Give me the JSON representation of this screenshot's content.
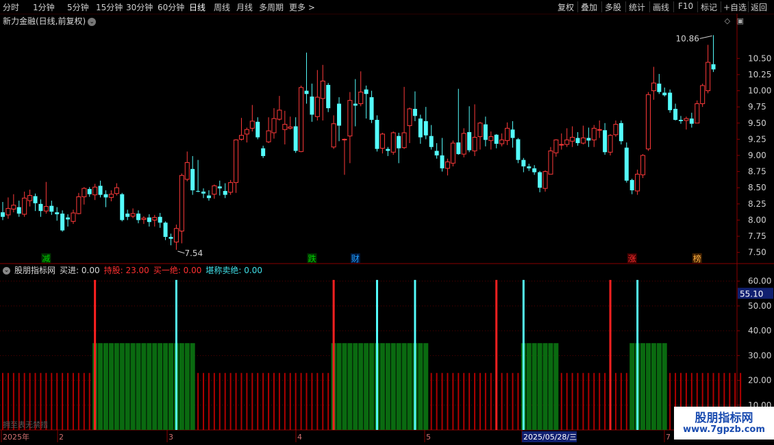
{
  "toolbar": {
    "left": [
      "分时",
      "1分钟",
      "5分钟",
      "15分钟",
      "30分钟",
      "60分钟",
      "日线",
      "周线",
      "月线",
      "多周期",
      "更多 >"
    ],
    "active": "日线",
    "right": [
      "复权",
      "叠加",
      "多股",
      "统计",
      "画线",
      "F10",
      "标记",
      "+自选",
      "返回"
    ]
  },
  "stock": {
    "title": "新力金融(日线,前复权)",
    "chevron": "⌄"
  },
  "price_axis": {
    "labels": [
      "10.50",
      "10.25",
      "10.00",
      "9.75",
      "9.50",
      "9.25",
      "9.00",
      "8.75",
      "8.50",
      "8.25",
      "8.00",
      "7.75",
      "7.50"
    ]
  },
  "annotations": {
    "high": "10.86",
    "low": "7.54"
  },
  "markers": [
    {
      "text": "减",
      "color": "#00d000",
      "bg": "#003000"
    },
    {
      "text": "跌",
      "color": "#00d000",
      "bg": "#003000"
    },
    {
      "text": "财",
      "color": "#20a0ff",
      "bg": "#001a40"
    },
    {
      "text": "涨",
      "color": "#ff3030",
      "bg": "#400000"
    },
    {
      "text": "榜",
      "color": "#ffb040",
      "bg": "#402000"
    }
  ],
  "indicator": {
    "name": "股朋指标网",
    "buy": "买进: 0.00",
    "hold": "持股: 23.00",
    "buy_all": "买一绝: 0.00",
    "sell_all": "堪称卖绝: 0.00",
    "axis_labels": [
      "60.00",
      "50.00",
      "40.00",
      "30.00",
      "20.00",
      "10.00"
    ],
    "current": "55.10"
  },
  "time_axis": {
    "labels": [
      "2025年",
      "2",
      "3",
      "4",
      "5",
      "2025/05/28/三",
      "7"
    ]
  },
  "watermark": {
    "cn": "股朋指标网",
    "url": "www.7gpzb.com"
  },
  "bottom_note": "拥至表无禁措",
  "chart_data": {
    "type": "candlestick",
    "ylim": [
      7.38,
      10.98
    ],
    "candles": [
      [
        8.12,
        8.05,
        8.28,
        8.0
      ],
      [
        8.08,
        8.18,
        8.35,
        8.02
      ],
      [
        8.17,
        8.23,
        8.4,
        8.12
      ],
      [
        8.2,
        8.1,
        8.3,
        8.05
      ],
      [
        8.09,
        8.34,
        8.44,
        8.05
      ],
      [
        8.3,
        8.38,
        8.47,
        8.21
      ],
      [
        8.37,
        8.26,
        8.41,
        8.14
      ],
      [
        8.25,
        8.14,
        8.32,
        8.05
      ],
      [
        8.14,
        8.21,
        8.59,
        8.1
      ],
      [
        8.22,
        8.13,
        8.3,
        8.08
      ],
      [
        8.12,
        8.09,
        8.2,
        7.99
      ],
      [
        8.1,
        7.84,
        8.15,
        7.82
      ],
      [
        8.04,
        8.01,
        8.09,
        7.9
      ],
      [
        7.98,
        8.11,
        8.16,
        7.94
      ],
      [
        8.1,
        8.36,
        8.42,
        8.09
      ],
      [
        8.36,
        8.49,
        8.51,
        8.24
      ],
      [
        8.48,
        8.4,
        8.51,
        8.36
      ],
      [
        8.39,
        8.51,
        8.56,
        8.31
      ],
      [
        8.53,
        8.39,
        8.61,
        8.35
      ],
      [
        8.4,
        8.35,
        8.46,
        8.2
      ],
      [
        8.35,
        8.4,
        8.46,
        8.29
      ],
      [
        8.41,
        8.5,
        8.57,
        8.38
      ],
      [
        8.4,
        8.0,
        8.42,
        7.98
      ],
      [
        8.1,
        8.05,
        8.16,
        8.0
      ],
      [
        8.06,
        8.1,
        8.18,
        8.03
      ],
      [
        8.1,
        8.0,
        8.15,
        7.95
      ],
      [
        8.01,
        8.03,
        8.06,
        7.94
      ],
      [
        8.04,
        7.97,
        8.09,
        7.9
      ],
      [
        8.0,
        8.04,
        8.08,
        7.9
      ],
      [
        8.05,
        7.96,
        8.11,
        7.88
      ],
      [
        7.96,
        7.74,
        7.98,
        7.69
      ],
      [
        7.74,
        7.71,
        7.79,
        7.61
      ],
      [
        7.66,
        7.87,
        7.93,
        7.54
      ],
      [
        7.83,
        8.69,
        8.72,
        7.64
      ],
      [
        8.63,
        8.89,
        9.06,
        8.6
      ],
      [
        8.79,
        8.46,
        8.99,
        8.39
      ],
      [
        8.45,
        8.44,
        8.93,
        8.43
      ],
      [
        8.44,
        8.41,
        8.49,
        8.34
      ],
      [
        8.38,
        8.34,
        8.46,
        8.3
      ],
      [
        8.4,
        8.53,
        8.55,
        8.33
      ],
      [
        8.52,
        8.49,
        8.61,
        8.38
      ],
      [
        8.45,
        8.39,
        8.57,
        8.34
      ],
      [
        8.43,
        8.58,
        8.62,
        8.39
      ],
      [
        8.58,
        9.24,
        9.25,
        8.42
      ],
      [
        9.25,
        9.31,
        9.58,
        9.23
      ],
      [
        9.33,
        9.4,
        9.43,
        9.2
      ],
      [
        9.42,
        9.53,
        9.78,
        9.37
      ],
      [
        9.52,
        9.28,
        9.59,
        9.25
      ],
      [
        9.11,
        8.99,
        9.15,
        8.96
      ],
      [
        9.21,
        9.38,
        9.59,
        9.19
      ],
      [
        9.35,
        9.57,
        9.73,
        9.26
      ],
      [
        9.56,
        9.7,
        9.92,
        9.54
      ],
      [
        9.4,
        9.48,
        9.69,
        9.17
      ],
      [
        9.42,
        9.44,
        9.6,
        9.4
      ],
      [
        9.45,
        9.07,
        9.59,
        9.04
      ],
      [
        9.06,
        10.05,
        10.08,
        9.05
      ],
      [
        10.0,
        9.95,
        10.59,
        9.8
      ],
      [
        9.91,
        9.63,
        10.11,
        9.52
      ],
      [
        9.6,
        9.9,
        10.32,
        9.54
      ],
      [
        9.88,
        10.15,
        10.4,
        9.54
      ],
      [
        10.09,
        9.73,
        10.12,
        9.67
      ],
      [
        9.13,
        9.49,
        9.62,
        9.1
      ],
      [
        9.8,
        9.46,
        9.9,
        9.22
      ],
      [
        9.24,
        9.25,
        9.26,
        8.7
      ],
      [
        9.3,
        9.85,
        9.98,
        8.88
      ],
      [
        9.8,
        9.77,
        10.18,
        9.45
      ],
      [
        9.8,
        9.98,
        10.3,
        9.76
      ],
      [
        10.02,
        9.95,
        10.08,
        9.57
      ],
      [
        9.9,
        9.55,
        10.0,
        9.5
      ],
      [
        9.55,
        9.1,
        9.62,
        9.06
      ],
      [
        9.11,
        9.33,
        9.35,
        9.03
      ],
      [
        9.1,
        9.07,
        9.13,
        8.99
      ],
      [
        9.05,
        9.35,
        9.37,
        9.01
      ],
      [
        9.3,
        9.11,
        9.35,
        8.88
      ],
      [
        9.12,
        9.35,
        10.06,
        9.1
      ],
      [
        9.46,
        9.72,
        9.74,
        9.19
      ],
      [
        9.72,
        9.61,
        9.99,
        9.53
      ],
      [
        9.57,
        9.28,
        9.63,
        9.18
      ],
      [
        9.53,
        9.31,
        9.75,
        9.25
      ],
      [
        9.3,
        9.13,
        9.47,
        9.09
      ],
      [
        9.07,
        9.0,
        9.19,
        8.95
      ],
      [
        9.0,
        8.8,
        9.27,
        8.75
      ],
      [
        8.8,
        8.9,
        8.95,
        8.69
      ],
      [
        8.88,
        9.19,
        9.23,
        8.83
      ],
      [
        9.2,
        9.02,
        10.03,
        9.01
      ],
      [
        9.02,
        9.34,
        9.42,
        8.97
      ],
      [
        9.36,
        9.08,
        9.76,
        9.05
      ],
      [
        9.07,
        9.28,
        9.79,
        8.99
      ],
      [
        9.29,
        9.5,
        9.52,
        9.09
      ],
      [
        9.48,
        9.24,
        9.6,
        9.14
      ],
      [
        9.23,
        9.29,
        9.37,
        9.09
      ],
      [
        9.32,
        9.18,
        9.33,
        9.11
      ],
      [
        9.18,
        9.24,
        9.34,
        9.14
      ],
      [
        9.23,
        9.42,
        9.51,
        9.16
      ],
      [
        9.4,
        9.27,
        9.53,
        9.12
      ],
      [
        9.25,
        8.93,
        9.27,
        8.88
      ],
      [
        8.93,
        8.83,
        8.96,
        8.74
      ],
      [
        8.83,
        8.8,
        8.87,
        8.76
      ],
      [
        8.8,
        8.74,
        8.85,
        8.7
      ],
      [
        8.74,
        8.5,
        8.76,
        8.43
      ],
      [
        8.49,
        8.75,
        8.77,
        8.44
      ],
      [
        8.71,
        9.07,
        9.13,
        8.71
      ],
      [
        9.04,
        9.24,
        9.25,
        8.98
      ],
      [
        9.17,
        9.17,
        9.34,
        9.09
      ],
      [
        9.17,
        9.24,
        9.42,
        9.13
      ],
      [
        9.22,
        9.28,
        9.45,
        9.13
      ],
      [
        9.27,
        9.19,
        9.36,
        9.15
      ],
      [
        9.19,
        9.27,
        9.46,
        9.17
      ],
      [
        9.27,
        9.23,
        9.43,
        9.13
      ],
      [
        9.24,
        9.42,
        9.47,
        9.13
      ],
      [
        9.4,
        9.4,
        9.54,
        9.27
      ],
      [
        9.39,
        9.05,
        9.5,
        9.01
      ],
      [
        9.05,
        9.31,
        9.33,
        9.0
      ],
      [
        9.32,
        9.48,
        9.54,
        9.29
      ],
      [
        9.5,
        9.22,
        9.54,
        9.17
      ],
      [
        9.12,
        8.61,
        9.2,
        8.58
      ],
      [
        8.62,
        8.46,
        8.64,
        8.4
      ],
      [
        8.45,
        8.71,
        8.78,
        8.39
      ],
      [
        8.7,
        9.0,
        9.02,
        8.65
      ],
      [
        9.1,
        9.94,
        9.98,
        9.07
      ],
      [
        10.0,
        10.12,
        10.37,
        9.86
      ],
      [
        10.11,
        9.98,
        10.26,
        9.95
      ],
      [
        9.97,
        9.93,
        10.05,
        9.91
      ],
      [
        9.97,
        9.7,
        10.02,
        9.66
      ],
      [
        9.72,
        9.55,
        9.8,
        9.54
      ],
      [
        9.55,
        9.53,
        9.61,
        9.49
      ],
      [
        9.54,
        9.57,
        9.6,
        9.4
      ],
      [
        9.57,
        9.49,
        9.66,
        9.43
      ],
      [
        9.5,
        9.8,
        9.85,
        9.5
      ],
      [
        9.8,
        10.08,
        10.11,
        9.75
      ],
      [
        10.0,
        10.44,
        10.71,
        9.96
      ],
      [
        10.41,
        10.33,
        10.86,
        10.29
      ]
    ],
    "indicator_series": {
      "hold_levels": [
        23,
        35
      ],
      "hold_state": [
        0,
        0,
        0,
        0,
        0,
        0,
        0,
        0,
        0,
        0,
        0,
        0,
        0,
        0,
        0,
        0,
        0,
        1,
        1,
        1,
        1,
        1,
        1,
        1,
        1,
        1,
        1,
        1,
        1,
        1,
        1,
        1,
        1,
        1,
        2,
        2,
        0,
        0,
        0,
        0,
        0,
        0,
        0,
        0,
        0,
        0,
        0,
        0,
        0,
        0,
        0,
        0,
        0,
        0,
        0,
        0,
        0,
        0,
        0,
        0,
        0,
        1,
        1,
        1,
        1,
        1,
        1,
        1,
        1,
        1,
        2,
        1,
        1,
        1,
        1,
        1,
        1,
        2,
        2,
        0,
        0,
        0,
        0,
        0,
        0,
        0,
        0,
        0,
        0,
        0,
        0,
        0,
        0,
        0,
        0,
        0,
        1,
        1,
        1,
        1,
        1,
        2,
        2,
        0,
        0,
        0,
        0,
        0,
        0,
        0,
        0,
        0,
        0,
        0,
        0,
        0,
        1,
        1,
        1,
        1,
        1,
        2,
        2,
        0,
        0,
        0,
        0,
        0,
        0,
        0,
        0,
        0,
        0,
        0,
        0,
        0,
        0
      ]
    }
  }
}
